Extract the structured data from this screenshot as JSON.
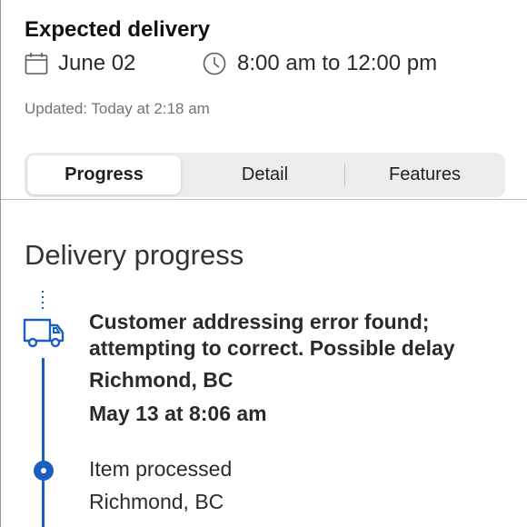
{
  "delivery": {
    "heading": "Expected delivery",
    "date": "June 02",
    "time_window": "8:00 am to 12:00 pm",
    "updated": "Updated: Today at 2:18 am"
  },
  "tabs": [
    {
      "label": "Progress",
      "active": true
    },
    {
      "label": "Detail",
      "active": false
    },
    {
      "label": "Features",
      "active": false
    }
  ],
  "progress": {
    "title": "Delivery progress",
    "events": [
      {
        "icon": "truck-icon",
        "status": "Customer addressing error found; attempting to correct. Possible delay",
        "location": "Richmond, BC",
        "time": "May 13 at 8:06 am"
      },
      {
        "icon": "timeline-node-icon",
        "status": "Item processed",
        "location": "Richmond, BC"
      }
    ]
  },
  "colors": {
    "accent": "#1a5fc0",
    "segment_bg": "#ececee",
    "muted_text": "#737373"
  }
}
